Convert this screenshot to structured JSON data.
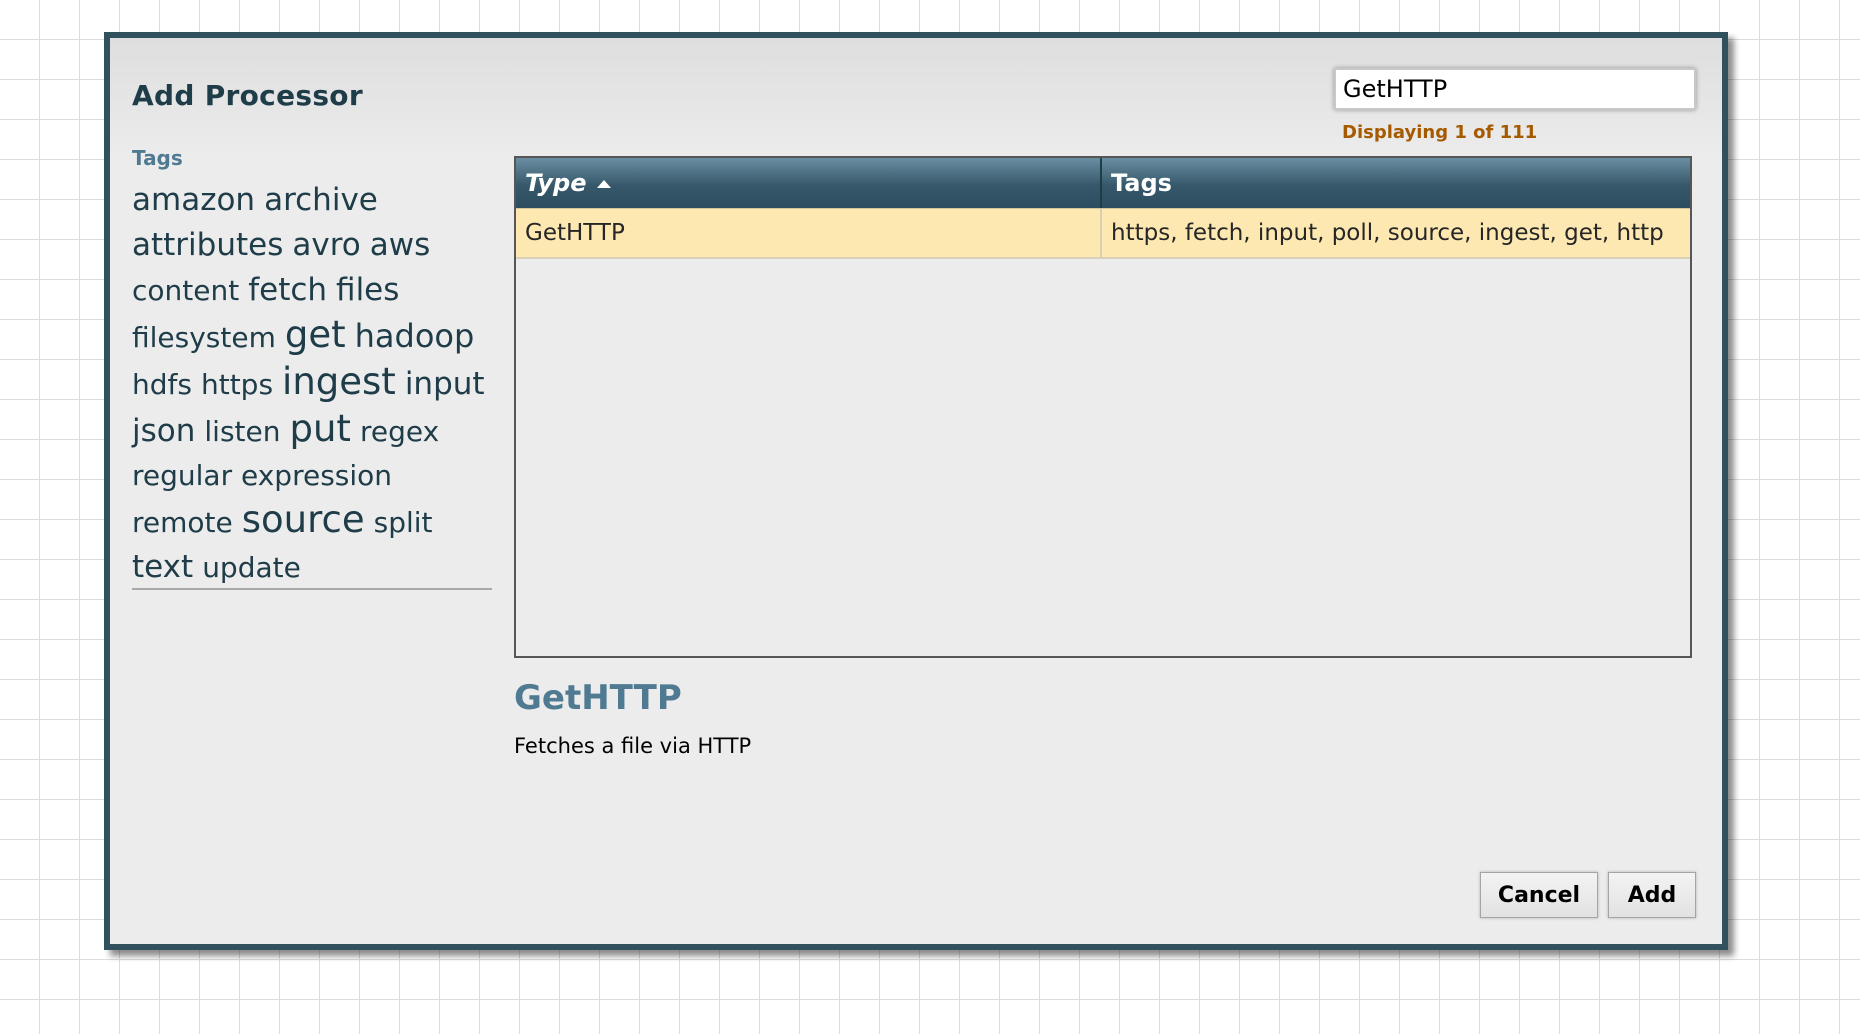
{
  "dialog": {
    "title": "Add Processor",
    "search": {
      "value": "GetHTTP",
      "placeholder": ""
    },
    "result_count": "Displaying 1 of 111"
  },
  "tags": {
    "heading": "Tags",
    "items": [
      {
        "label": "amazon",
        "weight": 2
      },
      {
        "label": "archive",
        "weight": 2
      },
      {
        "label": "attributes",
        "weight": 2
      },
      {
        "label": "avro",
        "weight": 2
      },
      {
        "label": "aws",
        "weight": 2
      },
      {
        "label": "content",
        "weight": 1
      },
      {
        "label": "fetch",
        "weight": 2
      },
      {
        "label": "files",
        "weight": 2
      },
      {
        "label": "filesystem",
        "weight": 1
      },
      {
        "label": "get",
        "weight": 4
      },
      {
        "label": "hadoop",
        "weight": 3
      },
      {
        "label": "hdfs",
        "weight": 1
      },
      {
        "label": "https",
        "weight": 1
      },
      {
        "label": "ingest",
        "weight": 4
      },
      {
        "label": "input",
        "weight": 2
      },
      {
        "label": "json",
        "weight": 2
      },
      {
        "label": "listen",
        "weight": 1
      },
      {
        "label": "put",
        "weight": 4
      },
      {
        "label": "regex",
        "weight": 1
      },
      {
        "label": "regular expression",
        "weight": 1
      },
      {
        "label": "remote",
        "weight": 1
      },
      {
        "label": "source",
        "weight": 4
      },
      {
        "label": "split",
        "weight": 1
      },
      {
        "label": "text",
        "weight": 2
      },
      {
        "label": "update",
        "weight": 1
      }
    ]
  },
  "table": {
    "columns": {
      "type": "Type",
      "tags": "Tags"
    },
    "sort": "ascending",
    "rows": [
      {
        "type": "GetHTTP",
        "tags": "https, fetch, input, poll, source, ingest, get, http",
        "selected": true
      }
    ]
  },
  "details": {
    "title": "GetHTTP",
    "description": "Fetches a file via HTTP"
  },
  "buttons": {
    "cancel": "Cancel",
    "add": "Add"
  },
  "colors": {
    "dialog_border": "#31515f",
    "header_gradient_top": "#6a8ea2",
    "header_gradient_bottom": "#2d4d60",
    "selected_row": "#fde8b2",
    "accent_text": "#4f7a92",
    "count_text": "#a65a00"
  }
}
